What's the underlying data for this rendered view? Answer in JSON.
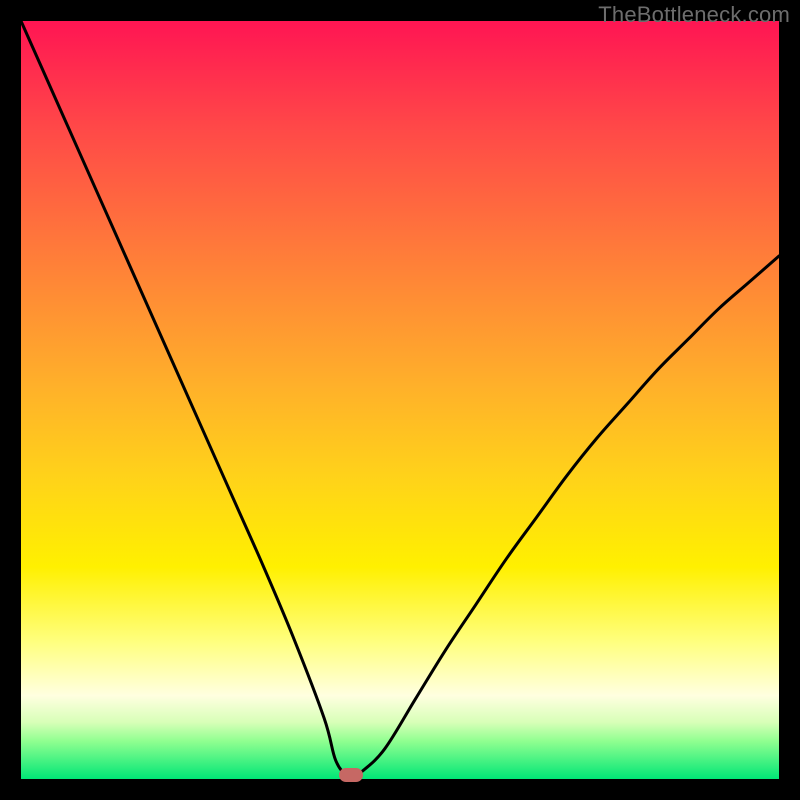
{
  "watermark": "TheBottleneck.com",
  "chart_data": {
    "type": "line",
    "title": "",
    "xlabel": "",
    "ylabel": "",
    "xlim": [
      0,
      100
    ],
    "ylim": [
      0,
      100
    ],
    "series": [
      {
        "name": "bottleneck-curve",
        "x": [
          0,
          4,
          8,
          12,
          16,
          20,
          24,
          28,
          32,
          36,
          40,
          41.5,
          43,
          44,
          45,
          48,
          52,
          56,
          60,
          64,
          68,
          72,
          76,
          80,
          84,
          88,
          92,
          96,
          100
        ],
        "values": [
          100,
          91,
          82,
          73,
          64,
          55,
          46,
          37,
          28,
          18.5,
          8,
          2.5,
          0.5,
          0.5,
          1,
          4,
          10.5,
          17,
          23,
          29,
          34.5,
          40,
          45,
          49.5,
          54,
          58,
          62,
          65.5,
          69
        ]
      }
    ],
    "marker": {
      "x": 43.5,
      "y": 0.5,
      "label": "optimal-point"
    },
    "grid": false,
    "legend": false
  }
}
